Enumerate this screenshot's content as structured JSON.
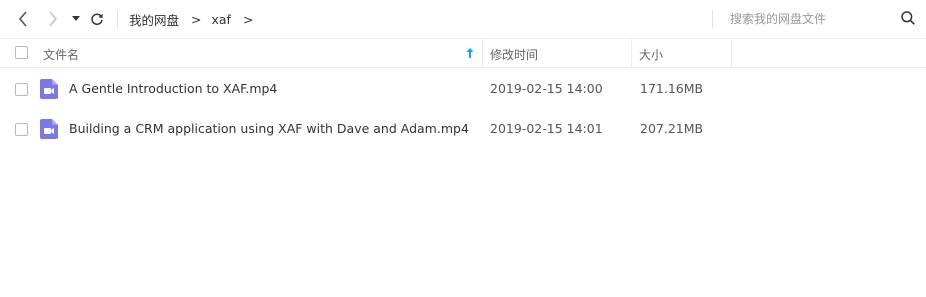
{
  "toolbar": {
    "breadcrumbs": [
      {
        "label": "我的网盘"
      },
      {
        "label": "xaf"
      }
    ],
    "crumb_separator": ">",
    "search_placeholder": "搜索我的网盘文件"
  },
  "table": {
    "columns": {
      "name": "文件名",
      "modified": "修改时间",
      "size": "大小"
    },
    "rows": [
      {
        "name": "A Gentle Introduction to XAF.mp4",
        "modified": "2019-02-15 14:00",
        "size": "171.16MB",
        "icon": "video-file-icon"
      },
      {
        "name": "Building a CRM application using XAF with Dave and Adam.mp4",
        "modified": "2019-02-15 14:01",
        "size": "207.21MB",
        "icon": "video-file-icon"
      }
    ]
  },
  "colors": {
    "accent": "#06a7ff",
    "video_icon": "#7b79e5"
  }
}
